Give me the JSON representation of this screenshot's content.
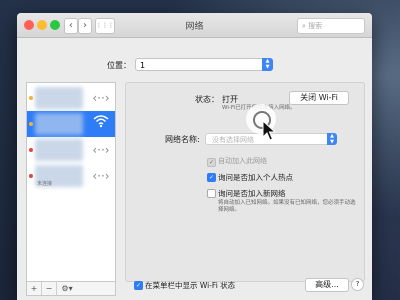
{
  "window": {
    "title": "网络",
    "search_placeholder": "搜索",
    "nav": {
      "back": "‹",
      "forward": "›",
      "grid": "⋮⋮⋮"
    }
  },
  "location": {
    "label": "位置：",
    "value": "1"
  },
  "sidebar": {
    "items": [
      {
        "status_color": "#f2b233",
        "icon": "network-icon",
        "selected": false
      },
      {
        "status_color": "#f2b233",
        "icon": "wifi-icon",
        "selected": true
      },
      {
        "status_color": "#e0443b",
        "icon": "network-icon",
        "selected": false
      },
      {
        "status_color": "#e0443b",
        "icon": "network-icon",
        "selected": false,
        "sub": "未连接"
      }
    ],
    "footer": {
      "add": "+",
      "remove": "−",
      "action": "⚙▾"
    }
  },
  "panel": {
    "status_label": "状态：",
    "status_value": "打开",
    "status_desc": "Wi-Fi已打开但尚未接入网络。",
    "turn_off_button": "关闭 Wi-Fi",
    "network_name_label": "网络名称:",
    "network_name_placeholder": "没有选择网络",
    "auto_join_label": "自动加入此网络",
    "ask_hotspots_label": "询问是否加入个人热点",
    "ask_new_networks_label": "询问是否加入新网络",
    "ask_new_networks_desc": "将自动加入已知网络。如果没有已知网络，您必须手动选择网络。",
    "show_wifi_menu_label": "在菜单栏中显示 Wi-Fi 状态",
    "advanced_button": "高级...",
    "help": "?"
  },
  "colors": {
    "accent": "#2f7df6",
    "warning": "#f2b233",
    "error": "#e0443b"
  }
}
